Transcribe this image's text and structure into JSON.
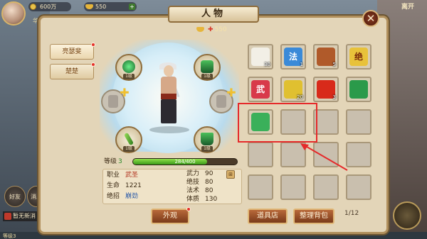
{
  "top": {
    "silver": "600万",
    "ingots": "550",
    "level_label": "华"
  },
  "window": {
    "title": "人物",
    "gold": "550",
    "close_label": "✕"
  },
  "tabs": [
    {
      "label": "亮瑟斐"
    },
    {
      "label": "楚楚"
    }
  ],
  "equipment": {
    "slot_level": "1级"
  },
  "level": {
    "label": "等级",
    "value": "3",
    "xp_text": "284/400",
    "xp_fraction": 0.71
  },
  "stats": {
    "job_label": "职业",
    "job": "武圣",
    "hp_label": "生命",
    "hp": "1221",
    "skill_label": "绝招",
    "skill": "崩劲",
    "force_label": "武力",
    "force": "90",
    "tech_label": "绝技",
    "tech": "80",
    "magic_label": "法术",
    "magic": "80",
    "body_label": "体质",
    "body": "130"
  },
  "buttons": {
    "appearance": "外观",
    "shop": "道具店",
    "sort": "整理背包"
  },
  "bag": {
    "items": [
      {
        "name": "bun",
        "count": "30",
        "color": "#f2efe6",
        "char": ""
      },
      {
        "name": "skill-book-fa",
        "count": "1",
        "color": "#3a8ad8",
        "char": "法"
      },
      {
        "name": "meat",
        "count": "5",
        "color": "#b05a2a",
        "char": ""
      },
      {
        "name": "skill-book-jue",
        "count": "",
        "color": "#e8c23a",
        "char": "绝"
      },
      {
        "name": "skill-book-wu",
        "count": "",
        "color": "#d83a4a",
        "char": "武"
      },
      {
        "name": "gold-token",
        "count": "20",
        "color": "#e0c030",
        "char": ""
      },
      {
        "name": "gift-box",
        "count": "3",
        "color": "#d82a1a",
        "char": ""
      },
      {
        "name": "green-glove",
        "count": "",
        "color": "#2a9a4a",
        "char": ""
      },
      {
        "name": "green-robe",
        "count": "",
        "color": "#3ab05a",
        "char": ""
      }
    ],
    "page": "1/12"
  },
  "left_side": {
    "friends": "好友",
    "message": "消息",
    "news": "暂无新消",
    "bottom_level": "等级3"
  },
  "right_side": {
    "leave": "离开"
  },
  "colors": {
    "accent_red": "#e52a2a",
    "wood": "#8f6d3c",
    "xp_green": "#3a9a1a"
  }
}
